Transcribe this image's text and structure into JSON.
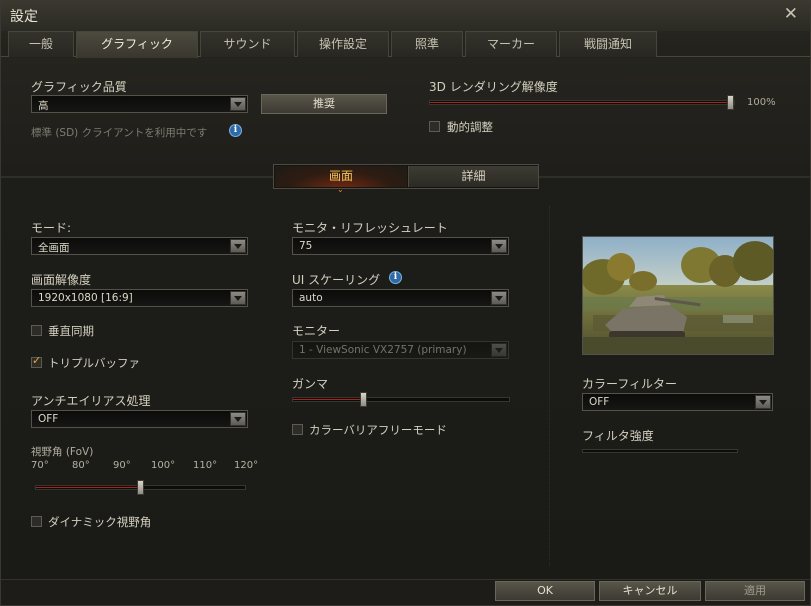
{
  "window": {
    "title": "設定",
    "close_glyph": "✕"
  },
  "tabs": [
    {
      "label": "一般",
      "active": false
    },
    {
      "label": "グラフィック",
      "active": true
    },
    {
      "label": "サウンド",
      "active": false
    },
    {
      "label": "操作設定",
      "active": false
    },
    {
      "label": "照準",
      "active": false
    },
    {
      "label": "マーカー",
      "active": false
    },
    {
      "label": "戦闘通知",
      "active": false
    }
  ],
  "quality": {
    "label": "グラフィック品質",
    "value": "高",
    "recommend_button": "推奨",
    "sd_note": "標準 (SD) クライアントを利用中です",
    "info_glyph": "i"
  },
  "render_resolution": {
    "label": "3D レンダリング解像度",
    "value_text": "100%",
    "level": 1.0,
    "dynamic_label": "動的調整",
    "dynamic_checked": false
  },
  "subtabs": {
    "screen": "画面",
    "detail": "詳細",
    "active": "screen",
    "chevron": "⌄"
  },
  "left": {
    "mode_label": "モード:",
    "mode_value": "全画面",
    "resolution_label": "画面解像度",
    "resolution_value": "1920x1080 [16:9]",
    "vsync_label": "垂直同期",
    "vsync_checked": false,
    "triple_label": "トリプルバッファ",
    "triple_checked": true,
    "aa_label": "アンチエイリアス処理",
    "aa_value": "OFF",
    "fov_label": "視野角 (FoV)",
    "fov_ticks": [
      "70°",
      "80°",
      "90°",
      "100°",
      "110°",
      "120°"
    ],
    "fov_level": 0.5,
    "dynamic_fov_label": "ダイナミック視野角",
    "dynamic_fov_checked": false
  },
  "middle": {
    "refresh_label": "モニタ・リフレッシュレート",
    "refresh_value": "75",
    "ui_scaling_label": "UI スケーリング",
    "ui_scaling_value": "auto",
    "monitor_label": "モニター",
    "monitor_value": "1 - ViewSonic VX2757 (primary)",
    "gamma_label": "ガンマ",
    "gamma_level": 0.32,
    "colorblind_label": "カラーバリアフリーモード",
    "colorblind_checked": false
  },
  "right": {
    "color_filter_label": "カラーフィルター",
    "color_filter_value": "OFF",
    "filter_strength_label": "フィルタ強度"
  },
  "footer": {
    "ok": "OK",
    "cancel": "キャンセル",
    "apply": "適用"
  },
  "colors": {
    "accent": "#f7c45a",
    "slider_fill": "#a8241c",
    "check": "#f0a830",
    "info": "#2d6aa7"
  }
}
